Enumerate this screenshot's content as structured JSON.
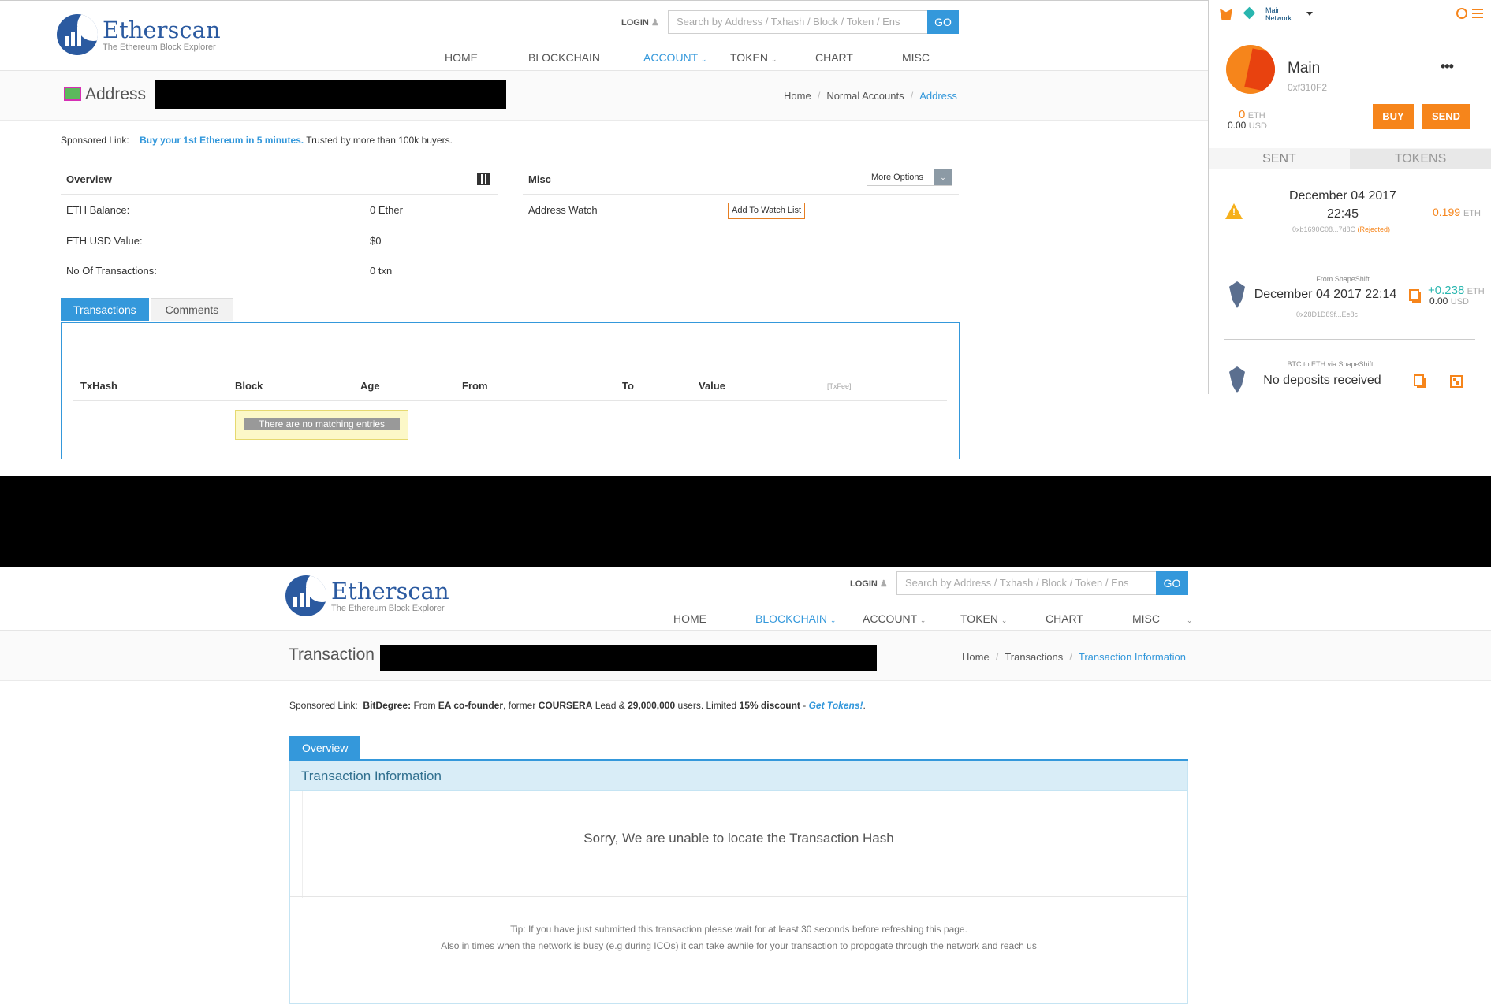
{
  "page1": {
    "brand": {
      "name": "Etherscan",
      "tagline": "The Ethereum Block Explorer"
    },
    "login": "LOGIN",
    "search_placeholder": "Search by Address / Txhash / Block / Token / Ens",
    "go": "GO",
    "nav": [
      "HOME",
      "BLOCKCHAIN",
      "ACCOUNT",
      "TOKEN",
      "CHART",
      "MISC"
    ],
    "active_nav": "ACCOUNT",
    "page_title": "Address",
    "breadcrumb": [
      "Home",
      "Normal Accounts",
      "Address"
    ],
    "sponsored_label": "Sponsored Link:",
    "sponsored_link": "Buy your 1st Ethereum in 5 minutes.",
    "sponsored_rest": "Trusted by more than 100k buyers.",
    "overview_title": "Overview",
    "overview_rows": [
      {
        "label": "ETH Balance:",
        "value": "0 Ether"
      },
      {
        "label": "ETH USD Value:",
        "value": "$0"
      },
      {
        "label": "No Of Transactions:",
        "value": "0 txn"
      }
    ],
    "misc_title": "Misc",
    "more_options": "More Options",
    "address_watch_label": "Address Watch",
    "add_watch_button": "Add To Watch List",
    "tabs": [
      "Transactions",
      "Comments"
    ],
    "table_headers": [
      "TxHash",
      "Block",
      "Age",
      "From",
      "To",
      "Value",
      "[TxFee]"
    ],
    "no_entries": "There are no matching entries"
  },
  "metamask": {
    "network": "Main Network",
    "account_name": "Main",
    "account_address": "0xf310F2",
    "eth_balance": "0",
    "eth_unit": "ETH",
    "usd_balance": "0.00",
    "usd_unit": "USD",
    "buy": "BUY",
    "send": "SEND",
    "tabs": [
      "SENT",
      "TOKENS"
    ],
    "tx1": {
      "date": "December 04 2017",
      "time": "22:45",
      "hash": "0xb1690C08...7d8C",
      "status": "(Rejected)",
      "amount": "0.199",
      "unit": "ETH"
    },
    "tx2": {
      "source": "From ShapeShift",
      "datetime": "December 04 2017 22:14",
      "hash": "0x28D1D89f...Ee8c",
      "amount": "+0.238",
      "unit": "ETH",
      "usd": "0.00",
      "usd_unit": "USD"
    },
    "tx3": {
      "source": "BTC to ETH via ShapeShift",
      "status": "No deposits received"
    }
  },
  "page2": {
    "brand": {
      "name": "Etherscan",
      "tagline": "The Ethereum Block Explorer"
    },
    "login": "LOGIN",
    "search_placeholder": "Search by Address / Txhash / Block / Token / Ens",
    "go": "GO",
    "nav": [
      "HOME",
      "BLOCKCHAIN",
      "ACCOUNT",
      "TOKEN",
      "CHART",
      "MISC"
    ],
    "active_nav": "BLOCKCHAIN",
    "page_title": "Transaction",
    "breadcrumb": [
      "Home",
      "Transactions",
      "Transaction Information"
    ],
    "sponsored_label": "Sponsored Link:",
    "sponsored_brand": "BitDegree:",
    "sponsored_t1": "From",
    "sponsored_b1": "EA co-founder",
    "sponsored_t2": ", former",
    "sponsored_b2": "COURSERA",
    "sponsored_t3": "Lead &",
    "sponsored_b3": "29,000,000",
    "sponsored_t4": "users. Limited",
    "sponsored_b4": "15% discount",
    "sponsored_t5": "-",
    "sponsored_link": "Get Tokens!",
    "sponsored_end": ".",
    "tab": "Overview",
    "info_title": "Transaction Information",
    "not_found": "Sorry, We are unable to locate the Transaction Hash",
    "dot": ".",
    "tip1": "Tip: If you have just submitted this transaction please wait for at least 30 seconds before refreshing this page.",
    "tip2": "Also in times when the network is busy (e.g during ICOs) it can take awhile for your transaction to propogate through the network and reach us"
  }
}
